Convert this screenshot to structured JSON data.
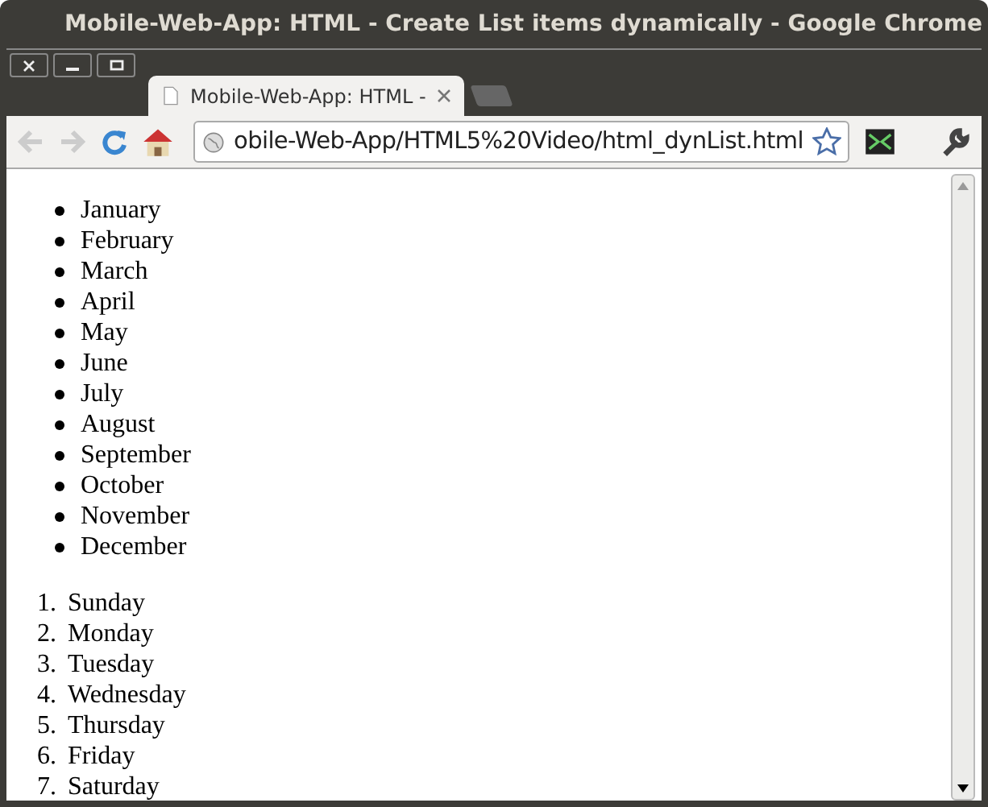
{
  "window": {
    "title": "Mobile-Web-App: HTML - Create List items dynamically - Google Chrome"
  },
  "tabs": [
    {
      "label": "Mobile-Web-App: HTML -",
      "selected": true
    }
  ],
  "address_bar": {
    "value": "obile-Web-App/HTML5%20Video/html_dynList.html"
  },
  "months": [
    "January",
    "February",
    "March",
    "April",
    "May",
    "June",
    "July",
    "August",
    "September",
    "October",
    "November",
    "December"
  ],
  "days": [
    {
      "number": "1.",
      "label": "Sunday"
    },
    {
      "number": "2.",
      "label": "Monday"
    },
    {
      "number": "3.",
      "label": "Tuesday"
    },
    {
      "number": "4.",
      "label": "Wednesday"
    },
    {
      "number": "5.",
      "label": "Thursday"
    },
    {
      "number": "6.",
      "label": "Friday"
    },
    {
      "number": "7.",
      "label": "Saturday"
    }
  ]
}
